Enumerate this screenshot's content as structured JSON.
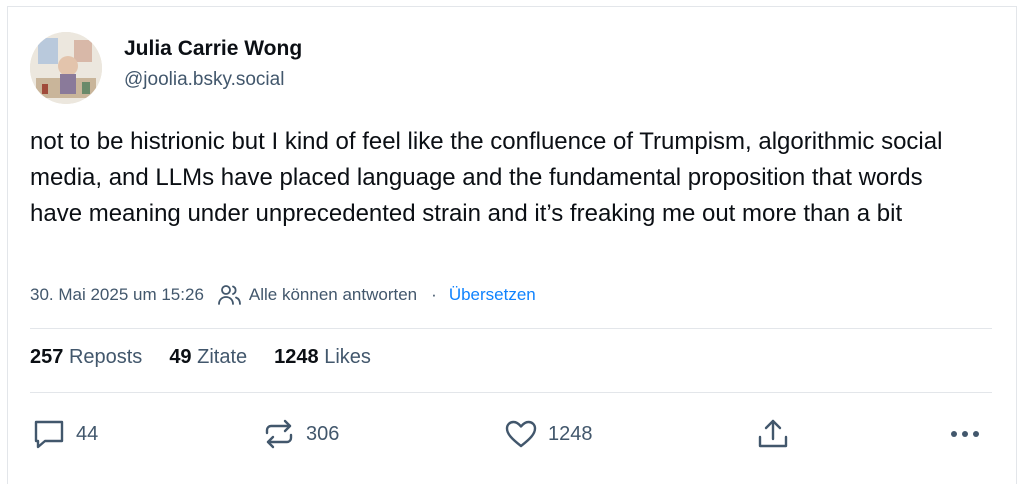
{
  "author": {
    "name": "Julia Carrie Wong",
    "handle": "@joolia.bsky.social"
  },
  "post": {
    "text": "not to be histrionic but I kind of feel like the confluence of Trumpism, algorithmic social media, and LLMs have placed language and the fundamental proposition that words have meaning under unprecedented strain and it’s freaking me out more than a bit"
  },
  "meta": {
    "timestamp": "30. Mai 2025 um 15:26",
    "reply_setting": "Alle können antworten",
    "separator": "·",
    "translate_label": "Übersetzen"
  },
  "stats": {
    "reposts": {
      "count": "257",
      "label": "Reposts"
    },
    "quotes": {
      "count": "49",
      "label": "Zitate"
    },
    "likes": {
      "count": "1248",
      "label": "Likes"
    }
  },
  "actions": {
    "reply_count": "44",
    "repost_count": "306",
    "like_count": "1248"
  },
  "icons": {
    "reply": "speech-bubble-icon",
    "repost": "repost-arrows-icon",
    "like": "heart-icon",
    "share": "share-upload-icon",
    "more": "more-dots-icon",
    "reply_setting": "people-icon"
  },
  "colors": {
    "text": "#0b0f14",
    "muted": "#42576c",
    "link": "#1083fe",
    "border": "#e3e6ea"
  }
}
